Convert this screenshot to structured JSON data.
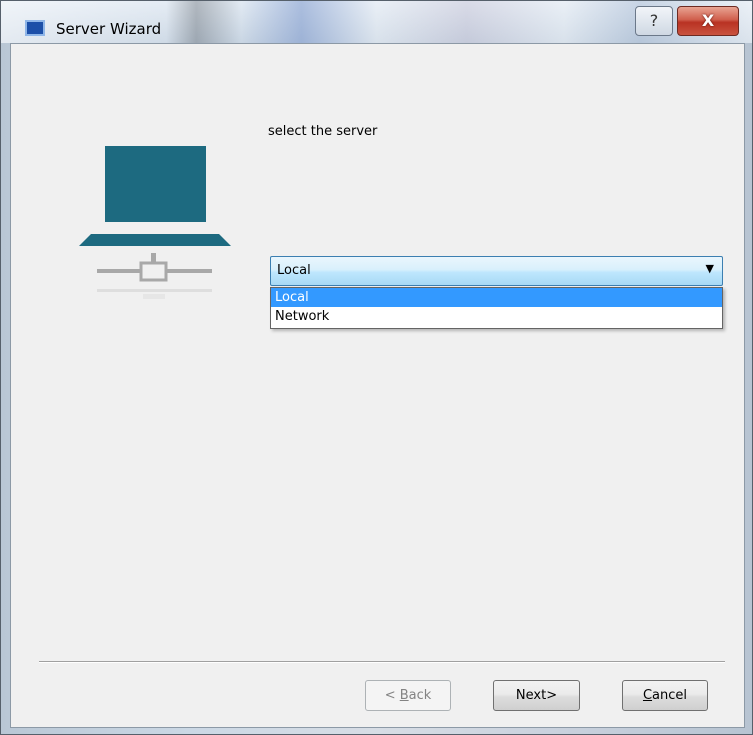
{
  "window": {
    "title": "Server Wizard",
    "help_glyph": "?",
    "close_glyph": "X"
  },
  "main": {
    "prompt": "select the server",
    "server_select": {
      "value": "Local",
      "options": [
        "Local",
        "Network"
      ],
      "highlighted_index": 0
    },
    "icon": "network-computer-icon"
  },
  "footer": {
    "back": {
      "pre": "< ",
      "mnemonic": "B",
      "post": "ack",
      "enabled": false
    },
    "next": {
      "label": "Next>"
    },
    "cancel": {
      "mnemonic": "C",
      "post": "ancel"
    }
  },
  "colors": {
    "accent": "#1d6a80",
    "selection": "#3399ff",
    "close_button": "#c9443a"
  }
}
